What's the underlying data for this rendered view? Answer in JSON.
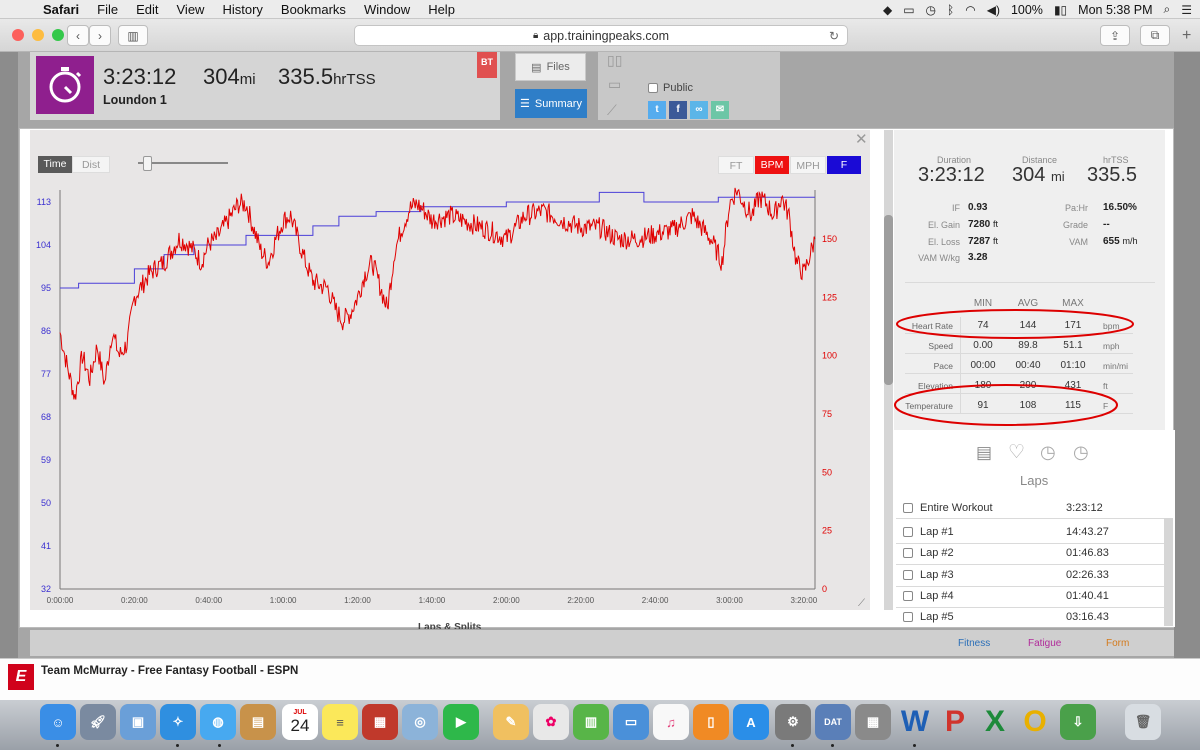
{
  "menubar": {
    "app": "Safari",
    "items": [
      "File",
      "Edit",
      "View",
      "History",
      "Bookmarks",
      "Window",
      "Help"
    ],
    "battery": "100%",
    "clock": "Mon 5:38 PM"
  },
  "browser": {
    "url": "app.trainingpeaks.com"
  },
  "workout": {
    "time": "3:23:12",
    "distance": "304",
    "distance_unit": "mi",
    "tss": "335.5",
    "tss_unit": "hrTSS",
    "name": "Loundon 1",
    "badge": "BT",
    "files_label": "Files",
    "summary_label": "Summary",
    "public_label": "Public"
  },
  "chart_toggles": {
    "time": "Time",
    "dist": "Dist",
    "series": [
      "FT",
      "BPM",
      "MPH",
      "F"
    ]
  },
  "chart_data": {
    "type": "line",
    "x_ticks": [
      "0:00:00",
      "0:20:00",
      "0:40:00",
      "1:00:00",
      "1:20:00",
      "1:40:00",
      "2:00:00",
      "2:20:00",
      "2:40:00",
      "3:00:00",
      "3:20:00"
    ],
    "x_range_min": [
      0,
      203
    ],
    "y_left": {
      "label": "F",
      "ticks": [
        32,
        41,
        50,
        59,
        68,
        77,
        86,
        95,
        104,
        113
      ],
      "range": [
        32,
        113
      ],
      "color": "#3a2fd0"
    },
    "y_right": {
      "label": "BPM",
      "ticks": [
        0,
        25,
        50,
        75,
        100,
        125,
        150
      ],
      "range": [
        0,
        171
      ],
      "color": "#e00000"
    },
    "series": [
      {
        "name": "F",
        "axis": "left",
        "color": "#4a3fd8",
        "x_min": [
          0,
          5,
          5,
          20,
          20,
          28,
          28,
          36,
          36,
          50,
          50,
          68,
          68,
          75,
          75,
          85,
          85,
          97,
          97,
          120,
          120,
          145,
          145,
          157,
          157,
          177,
          177,
          203
        ],
        "values": [
          95,
          95,
          96,
          96,
          99,
          99,
          102,
          102,
          104,
          104,
          106,
          106,
          108,
          108,
          110,
          110,
          111,
          111,
          112,
          112,
          113,
          113,
          115,
          115,
          113,
          113,
          114,
          114
        ]
      },
      {
        "name": "BPM",
        "axis": "right",
        "color": "#e00000",
        "x_min": [
          0,
          2,
          4,
          6,
          8,
          10,
          12,
          14,
          16,
          18,
          20,
          22,
          24,
          26,
          28,
          30,
          32,
          34,
          36,
          38,
          40,
          42,
          44,
          46,
          48,
          50,
          52,
          54,
          56,
          58,
          60,
          62,
          64,
          66,
          68,
          70,
          72,
          74,
          76,
          78,
          80,
          82,
          84,
          86,
          88,
          90,
          92,
          94,
          96,
          98,
          100,
          105,
          110,
          115,
          120,
          125,
          130,
          135,
          140,
          145,
          150,
          155,
          160,
          165,
          170,
          175,
          178,
          180,
          182,
          184,
          186,
          188,
          190,
          192,
          194,
          196,
          198,
          200,
          203
        ],
        "values": [
          110,
          95,
          82,
          100,
          90,
          104,
          88,
          110,
          100,
          105,
          125,
          130,
          135,
          138,
          140,
          145,
          150,
          148,
          145,
          140,
          148,
          150,
          155,
          160,
          165,
          165,
          155,
          145,
          140,
          150,
          158,
          160,
          150,
          140,
          132,
          130,
          129,
          120,
          115,
          118,
          125,
          135,
          140,
          130,
          120,
          145,
          155,
          163,
          165,
          162,
          158,
          160,
          157,
          154,
          150,
          160,
          162,
          158,
          155,
          155,
          150,
          150,
          152,
          154,
          160,
          150,
          140,
          165,
          171,
          165,
          160,
          168,
          165,
          160,
          168,
          160,
          140,
          135,
          150
        ]
      }
    ]
  },
  "summary": {
    "duration_label": "Duration",
    "duration": "3:23:12",
    "distance_label": "Distance",
    "distance": "304",
    "distance_unit": "mi",
    "tss_label": "hrTSS",
    "tss": "335.5",
    "left_metrics": [
      {
        "label": "IF",
        "value": "0.93",
        "unit": ""
      },
      {
        "label": "El. Gain",
        "value": "7280",
        "unit": "ft"
      },
      {
        "label": "El. Loss",
        "value": "7287",
        "unit": "ft"
      },
      {
        "label": "VAM W/kg",
        "value": "3.28",
        "unit": ""
      }
    ],
    "right_metrics": [
      {
        "label": "Pa:Hr",
        "value": "16.50%",
        "unit": ""
      },
      {
        "label": "Grade",
        "value": "--",
        "unit": ""
      },
      {
        "label": "VAM",
        "value": "655",
        "unit": "m/h"
      }
    ],
    "table_headers": [
      "MIN",
      "AVG",
      "MAX"
    ],
    "table_rows": [
      {
        "label": "Heart Rate",
        "min": "74",
        "avg": "144",
        "max": "171",
        "unit": "bpm"
      },
      {
        "label": "Speed",
        "min": "0.00",
        "avg": "89.8",
        "max": "51.1",
        "unit": "mph"
      },
      {
        "label": "Pace",
        "min": "00:00",
        "avg": "00:40",
        "max": "01:10",
        "unit": "min/mi"
      },
      {
        "label": "Elevation",
        "min": "180",
        "avg": "290",
        "max": "431",
        "unit": "ft"
      },
      {
        "label": "Temperature",
        "min": "91",
        "avg": "108",
        "max": "115",
        "unit": "F"
      }
    ]
  },
  "laps": {
    "title": "Laps",
    "rows": [
      {
        "label": "Entire Workout",
        "value": "3:23:12"
      },
      {
        "label": "Lap #1",
        "value": "14:43.27"
      },
      {
        "label": "Lap #2",
        "value": "01:46.83"
      },
      {
        "label": "Lap #3",
        "value": "02:26.33"
      },
      {
        "label": "Lap #4",
        "value": "01:40.41"
      },
      {
        "label": "Lap #5",
        "value": "03:16.43"
      }
    ]
  },
  "below_strip": {
    "section_title": "Laps & Splits",
    "fitness": "Fitness",
    "fatigue": "Fatigue",
    "form": "Form"
  },
  "notification": {
    "text": "Team McMurray - Free Fantasy Football - ESPN"
  },
  "dock": {
    "calendar_month": "JUL",
    "calendar_day": "24"
  }
}
